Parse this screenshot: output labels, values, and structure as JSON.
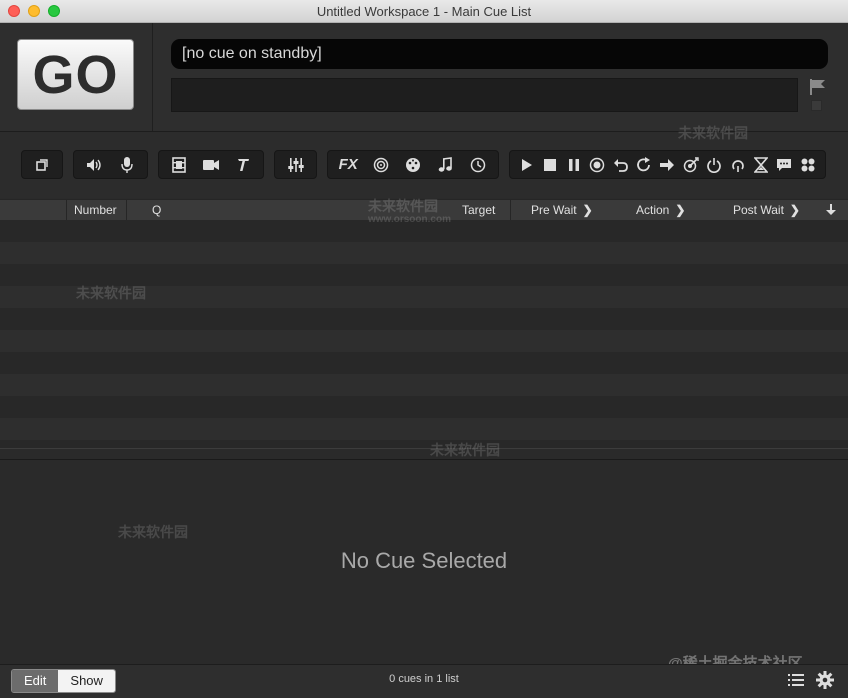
{
  "window": {
    "title": "Untitled Workspace 1 - Main Cue List"
  },
  "go_button": {
    "label": "GO"
  },
  "standby": {
    "text": "[no cue on standby]"
  },
  "toolbar": {
    "fx_label": "FX"
  },
  "columns": {
    "number": "Number",
    "q": "Q",
    "target": "Target",
    "pre_wait": "Pre Wait",
    "action": "Action",
    "post_wait": "Post Wait"
  },
  "inspector": {
    "empty_text": "No Cue Selected"
  },
  "footer": {
    "edit_label": "Edit",
    "show_label": "Show",
    "status": "0 cues in 1 list"
  },
  "watermarks": {
    "brand": "未来软件园",
    "url": "www.orsoon.com",
    "corner": "@稀土掘金技术社区"
  },
  "colors": {
    "background": "#2b2b2b",
    "go_face": "#e6e6e6",
    "standby_bg": "#060606"
  }
}
